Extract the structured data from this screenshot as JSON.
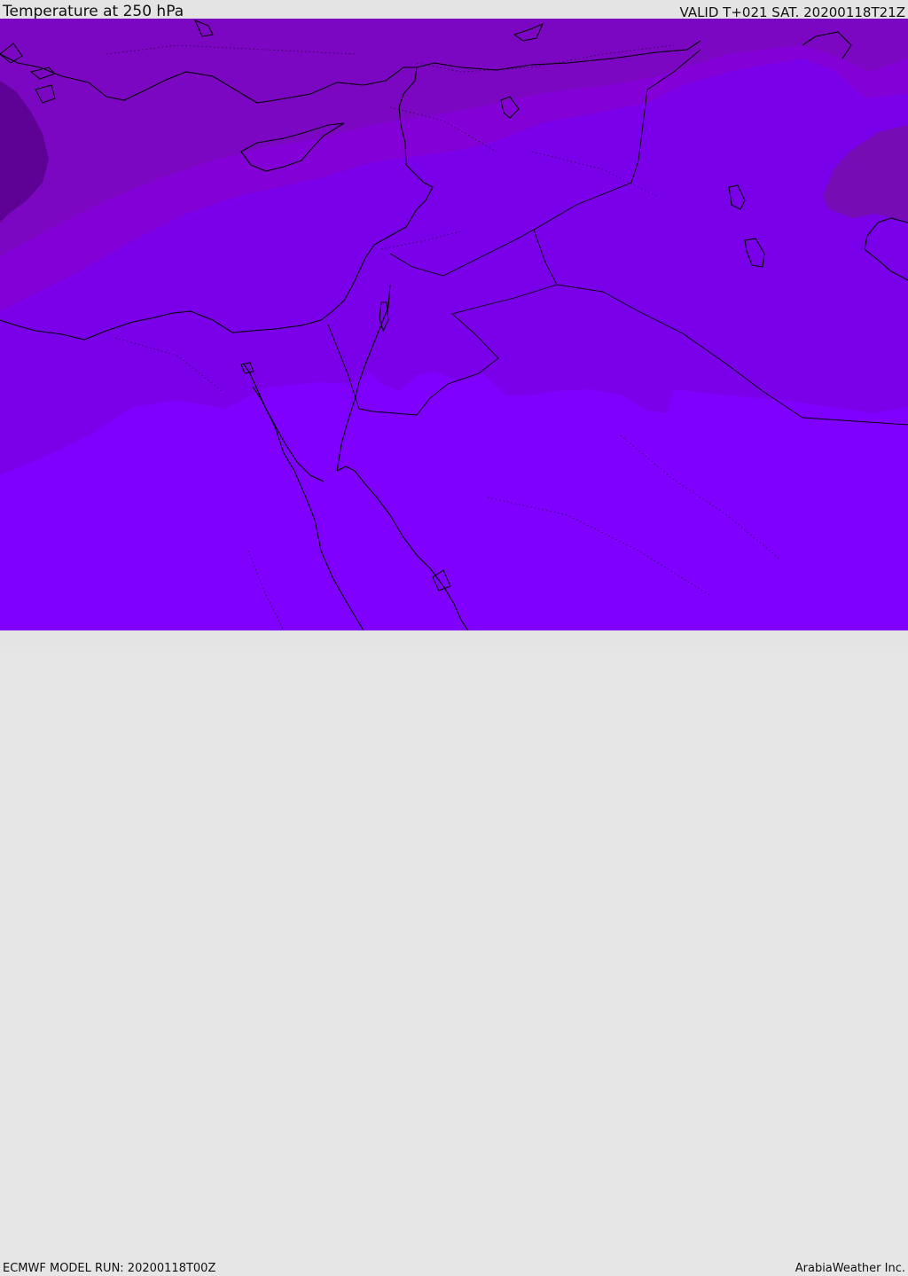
{
  "header": {
    "title": "Temperature at 250 hPa",
    "valid_time": "VALID T+021 SAT. 20200118T21Z"
  },
  "footer": {
    "model_run": "ECMWF MODEL RUN: 20200118T00Z",
    "credit": "ArabiaWeather Inc."
  },
  "map": {
    "region": "Eastern Mediterranean and Middle East",
    "field": "temperature",
    "level": "250 hPa",
    "colors": {
      "coldest": "#5e0296",
      "colder": "#760cb4",
      "cold": "#8300d6",
      "mid": "#7a00ea",
      "warm": "#7f00ff",
      "lines": "#000000"
    }
  }
}
